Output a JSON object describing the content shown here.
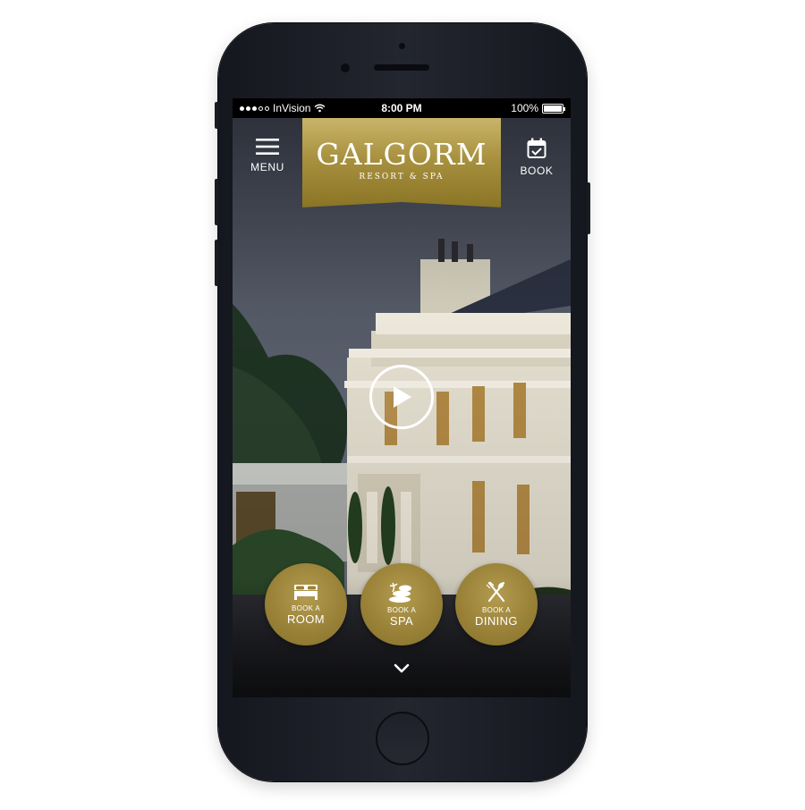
{
  "status_bar": {
    "carrier": "InVision",
    "time": "8:00 PM",
    "battery": "100%",
    "battery_level": 1.0
  },
  "header": {
    "menu_label": "MENU",
    "book_label": "BOOK",
    "logo_title": "GALGORM",
    "logo_subtitle": "RESORT & SPA"
  },
  "actions": [
    {
      "small": "BOOK A",
      "big": "ROOM",
      "icon": "bed-icon"
    },
    {
      "small": "BOOK A",
      "big": "SPA",
      "icon": "spa-stones-icon"
    },
    {
      "small": "BOOK A",
      "big": "DINING",
      "icon": "fork-knife-icon"
    }
  ],
  "colors": {
    "gold": "#a8913f",
    "phone_body": "#1d1f27",
    "status_bar": "#000000",
    "white": "#ffffff"
  },
  "icons": {
    "menu": "hamburger-icon",
    "book": "calendar-check-icon",
    "play": "play-icon",
    "scroll": "chevron-down-icon",
    "wifi": "wifi-icon",
    "battery": "battery-icon"
  }
}
